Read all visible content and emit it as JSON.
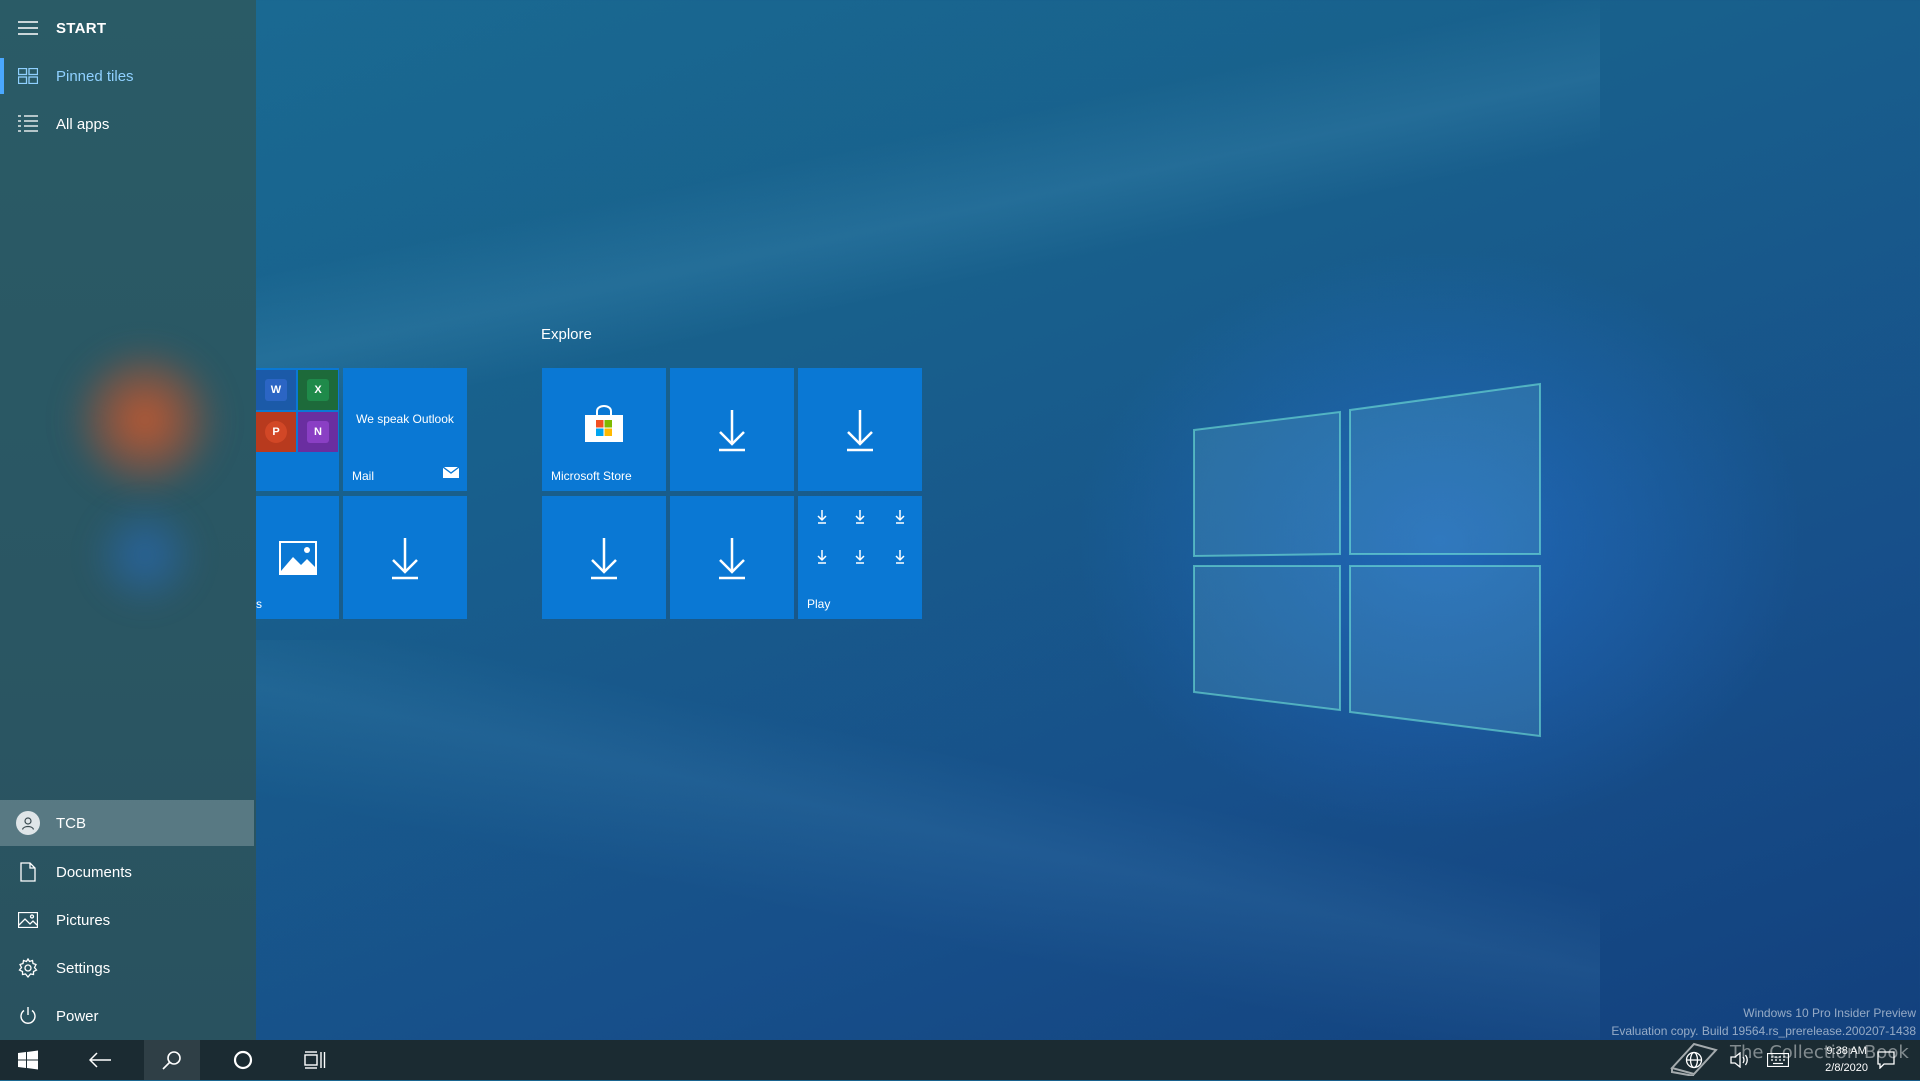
{
  "start": {
    "title": "START",
    "top_items": [
      {
        "label": "Pinned tiles",
        "icon": "pinned-tiles-icon",
        "active": true
      },
      {
        "label": "All apps",
        "icon": "all-apps-icon",
        "active": false
      }
    ],
    "bottom_items": [
      {
        "label": "TCB",
        "icon": "user-avatar-icon"
      },
      {
        "label": "Documents",
        "icon": "document-icon"
      },
      {
        "label": "Pictures",
        "icon": "pictures-icon"
      },
      {
        "label": "Settings",
        "icon": "gear-icon"
      },
      {
        "label": "Power",
        "icon": "power-icon"
      }
    ]
  },
  "tiles": {
    "group_explore_label": "Explore",
    "mail": {
      "headline": "We speak Outlook",
      "label": "Mail"
    },
    "office_apps": [
      "W",
      "X",
      "P",
      "N"
    ],
    "photos_label": "s",
    "store_label": "Microsoft Store",
    "play_label": "Play"
  },
  "watermark": {
    "line1": "Windows 10 Pro Insider Preview",
    "line2": "Evaluation copy. Build 19564.rs_prerelease.200207-1438"
  },
  "taskbar": {
    "time": "9:38 AM",
    "date": "2/8/2020",
    "brand_overlay": "The Collection Book"
  },
  "colors": {
    "tile": "#0a78d4",
    "accent": "#4aa8ff",
    "taskbar": "#1b2b32",
    "sidebar": "#2a5663"
  }
}
